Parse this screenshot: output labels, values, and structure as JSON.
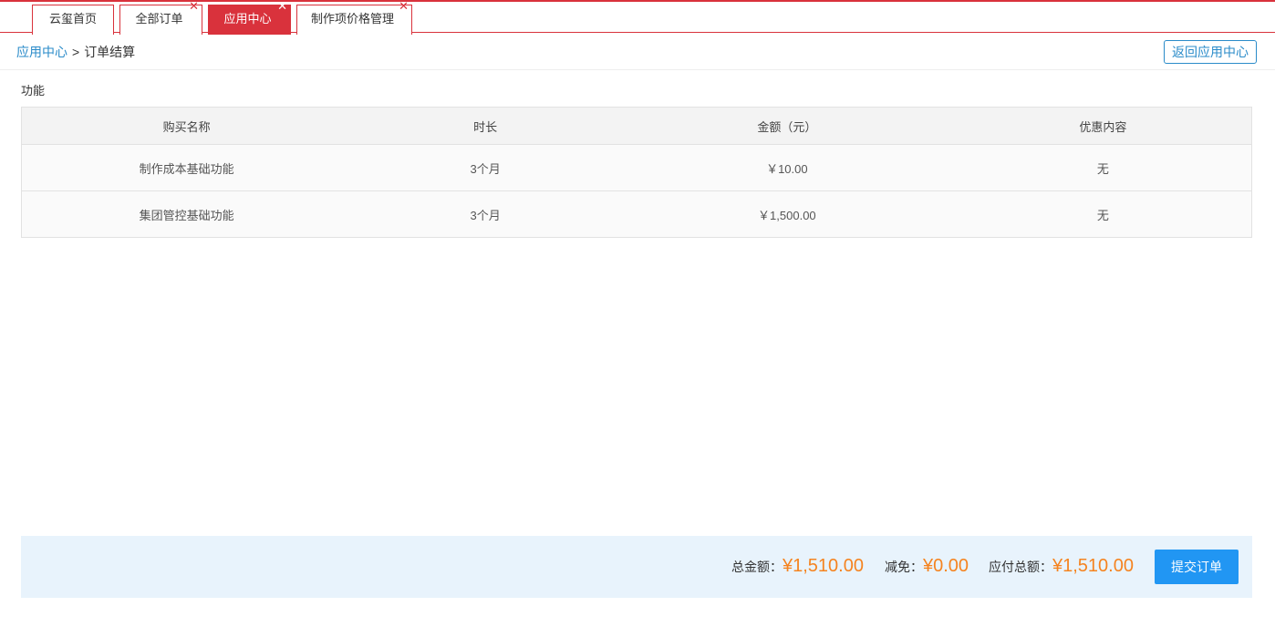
{
  "tabs": [
    {
      "label": "云玺首页",
      "closable": false,
      "active": false
    },
    {
      "label": "全部订单",
      "closable": true,
      "active": false
    },
    {
      "label": "应用中心",
      "closable": true,
      "active": true
    },
    {
      "label": "制作项价格管理",
      "closable": true,
      "active": false
    }
  ],
  "close_glyph": "✕",
  "breadcrumb": {
    "parent": "应用中心",
    "separator": ">",
    "current": "订单结算"
  },
  "back_button": "返回应用中心",
  "section_title": "功能",
  "table": {
    "headers": [
      "购买名称",
      "时长",
      "金额（元）",
      "优惠内容"
    ],
    "rows": [
      [
        "制作成本基础功能",
        "3个月",
        "￥10.00",
        "无"
      ],
      [
        "集团管控基础功能",
        "3个月",
        "￥1,500.00",
        "无"
      ]
    ]
  },
  "summary": {
    "total_label": "总金额：",
    "total_value": "¥1,510.00",
    "discount_label": "减免：",
    "discount_value": "¥0.00",
    "payable_label": "应付总额：",
    "payable_value": "¥1,510.00"
  },
  "submit_button": "提交订单",
  "colors": {
    "accent_red": "#d9323c",
    "link_blue": "#2a8bc9",
    "primary_button": "#2196f3",
    "amount_orange": "#f5831f",
    "footer_bg": "#e8f3fc"
  }
}
